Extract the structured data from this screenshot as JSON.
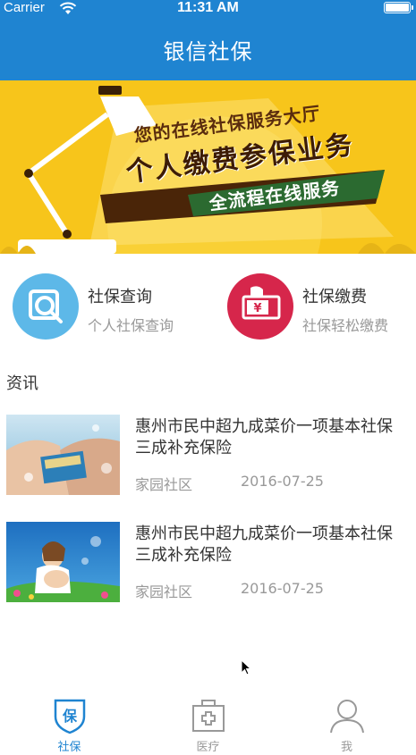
{
  "status_bar": {
    "carrier": "Carrier",
    "time": "11:31 AM",
    "wifi_icon": "wifi-icon",
    "battery_icon": "battery-icon"
  },
  "nav": {
    "title": "银信社保",
    "background": "#1f84d1"
  },
  "banner": {
    "line1": "您的在线社保服务大厅",
    "line2": "个人缴费参保业务",
    "line3": "全流程在线服务",
    "background": "#f7c51b"
  },
  "services": [
    {
      "title": "社保查询",
      "subtitle": "个人社保查询",
      "icon": "search-icon",
      "color": "#5db8e8"
    },
    {
      "title": "社保缴费",
      "subtitle": "社保轻松缴费",
      "icon": "payment-icon",
      "color": "#d6264b"
    }
  ],
  "news": {
    "section_label": "资讯",
    "items": [
      {
        "title": "惠州市民中超九成菜价一项基本社保三成补充保险",
        "source": "家园社区",
        "date": "2016-07-25"
      },
      {
        "title": "惠州市民中超九成菜价一项基本社保三成补充保险",
        "source": "家园社区",
        "date": "2016-07-25"
      }
    ]
  },
  "tabbar": {
    "active_color": "#1f84d1",
    "inactive_color": "#999999",
    "tabs": [
      {
        "label": "社保",
        "icon": "shield-icon",
        "icon_text": "保",
        "active": true
      },
      {
        "label": "医疗",
        "icon": "medical-kit-icon",
        "active": false
      },
      {
        "label": "我",
        "icon": "user-icon",
        "active": false
      }
    ]
  }
}
